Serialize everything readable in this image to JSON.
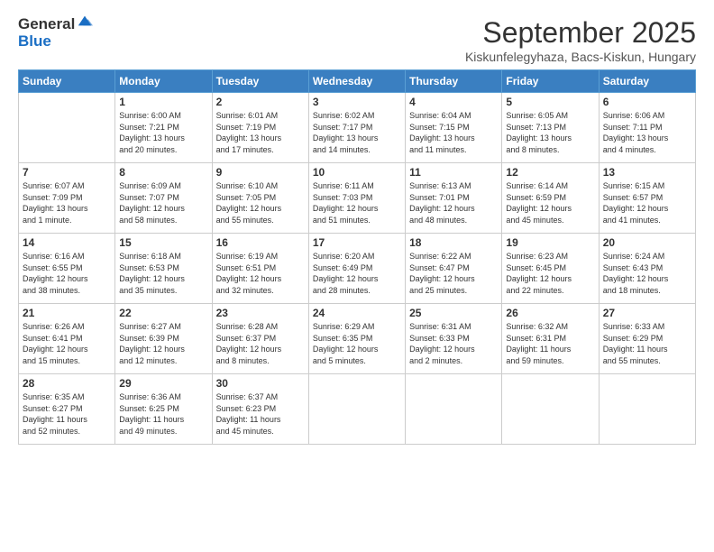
{
  "logo": {
    "general": "General",
    "blue": "Blue"
  },
  "header": {
    "month": "September 2025",
    "location": "Kiskunfelegyhaza, Bacs-Kiskun, Hungary"
  },
  "weekdays": [
    "Sunday",
    "Monday",
    "Tuesday",
    "Wednesday",
    "Thursday",
    "Friday",
    "Saturday"
  ],
  "weeks": [
    [
      {
        "day": "",
        "info": ""
      },
      {
        "day": "1",
        "info": "Sunrise: 6:00 AM\nSunset: 7:21 PM\nDaylight: 13 hours\nand 20 minutes."
      },
      {
        "day": "2",
        "info": "Sunrise: 6:01 AM\nSunset: 7:19 PM\nDaylight: 13 hours\nand 17 minutes."
      },
      {
        "day": "3",
        "info": "Sunrise: 6:02 AM\nSunset: 7:17 PM\nDaylight: 13 hours\nand 14 minutes."
      },
      {
        "day": "4",
        "info": "Sunrise: 6:04 AM\nSunset: 7:15 PM\nDaylight: 13 hours\nand 11 minutes."
      },
      {
        "day": "5",
        "info": "Sunrise: 6:05 AM\nSunset: 7:13 PM\nDaylight: 13 hours\nand 8 minutes."
      },
      {
        "day": "6",
        "info": "Sunrise: 6:06 AM\nSunset: 7:11 PM\nDaylight: 13 hours\nand 4 minutes."
      }
    ],
    [
      {
        "day": "7",
        "info": "Sunrise: 6:07 AM\nSunset: 7:09 PM\nDaylight: 13 hours\nand 1 minute."
      },
      {
        "day": "8",
        "info": "Sunrise: 6:09 AM\nSunset: 7:07 PM\nDaylight: 12 hours\nand 58 minutes."
      },
      {
        "day": "9",
        "info": "Sunrise: 6:10 AM\nSunset: 7:05 PM\nDaylight: 12 hours\nand 55 minutes."
      },
      {
        "day": "10",
        "info": "Sunrise: 6:11 AM\nSunset: 7:03 PM\nDaylight: 12 hours\nand 51 minutes."
      },
      {
        "day": "11",
        "info": "Sunrise: 6:13 AM\nSunset: 7:01 PM\nDaylight: 12 hours\nand 48 minutes."
      },
      {
        "day": "12",
        "info": "Sunrise: 6:14 AM\nSunset: 6:59 PM\nDaylight: 12 hours\nand 45 minutes."
      },
      {
        "day": "13",
        "info": "Sunrise: 6:15 AM\nSunset: 6:57 PM\nDaylight: 12 hours\nand 41 minutes."
      }
    ],
    [
      {
        "day": "14",
        "info": "Sunrise: 6:16 AM\nSunset: 6:55 PM\nDaylight: 12 hours\nand 38 minutes."
      },
      {
        "day": "15",
        "info": "Sunrise: 6:18 AM\nSunset: 6:53 PM\nDaylight: 12 hours\nand 35 minutes."
      },
      {
        "day": "16",
        "info": "Sunrise: 6:19 AM\nSunset: 6:51 PM\nDaylight: 12 hours\nand 32 minutes."
      },
      {
        "day": "17",
        "info": "Sunrise: 6:20 AM\nSunset: 6:49 PM\nDaylight: 12 hours\nand 28 minutes."
      },
      {
        "day": "18",
        "info": "Sunrise: 6:22 AM\nSunset: 6:47 PM\nDaylight: 12 hours\nand 25 minutes."
      },
      {
        "day": "19",
        "info": "Sunrise: 6:23 AM\nSunset: 6:45 PM\nDaylight: 12 hours\nand 22 minutes."
      },
      {
        "day": "20",
        "info": "Sunrise: 6:24 AM\nSunset: 6:43 PM\nDaylight: 12 hours\nand 18 minutes."
      }
    ],
    [
      {
        "day": "21",
        "info": "Sunrise: 6:26 AM\nSunset: 6:41 PM\nDaylight: 12 hours\nand 15 minutes."
      },
      {
        "day": "22",
        "info": "Sunrise: 6:27 AM\nSunset: 6:39 PM\nDaylight: 12 hours\nand 12 minutes."
      },
      {
        "day": "23",
        "info": "Sunrise: 6:28 AM\nSunset: 6:37 PM\nDaylight: 12 hours\nand 8 minutes."
      },
      {
        "day": "24",
        "info": "Sunrise: 6:29 AM\nSunset: 6:35 PM\nDaylight: 12 hours\nand 5 minutes."
      },
      {
        "day": "25",
        "info": "Sunrise: 6:31 AM\nSunset: 6:33 PM\nDaylight: 12 hours\nand 2 minutes."
      },
      {
        "day": "26",
        "info": "Sunrise: 6:32 AM\nSunset: 6:31 PM\nDaylight: 11 hours\nand 59 minutes."
      },
      {
        "day": "27",
        "info": "Sunrise: 6:33 AM\nSunset: 6:29 PM\nDaylight: 11 hours\nand 55 minutes."
      }
    ],
    [
      {
        "day": "28",
        "info": "Sunrise: 6:35 AM\nSunset: 6:27 PM\nDaylight: 11 hours\nand 52 minutes."
      },
      {
        "day": "29",
        "info": "Sunrise: 6:36 AM\nSunset: 6:25 PM\nDaylight: 11 hours\nand 49 minutes."
      },
      {
        "day": "30",
        "info": "Sunrise: 6:37 AM\nSunset: 6:23 PM\nDaylight: 11 hours\nand 45 minutes."
      },
      {
        "day": "",
        "info": ""
      },
      {
        "day": "",
        "info": ""
      },
      {
        "day": "",
        "info": ""
      },
      {
        "day": "",
        "info": ""
      }
    ]
  ]
}
